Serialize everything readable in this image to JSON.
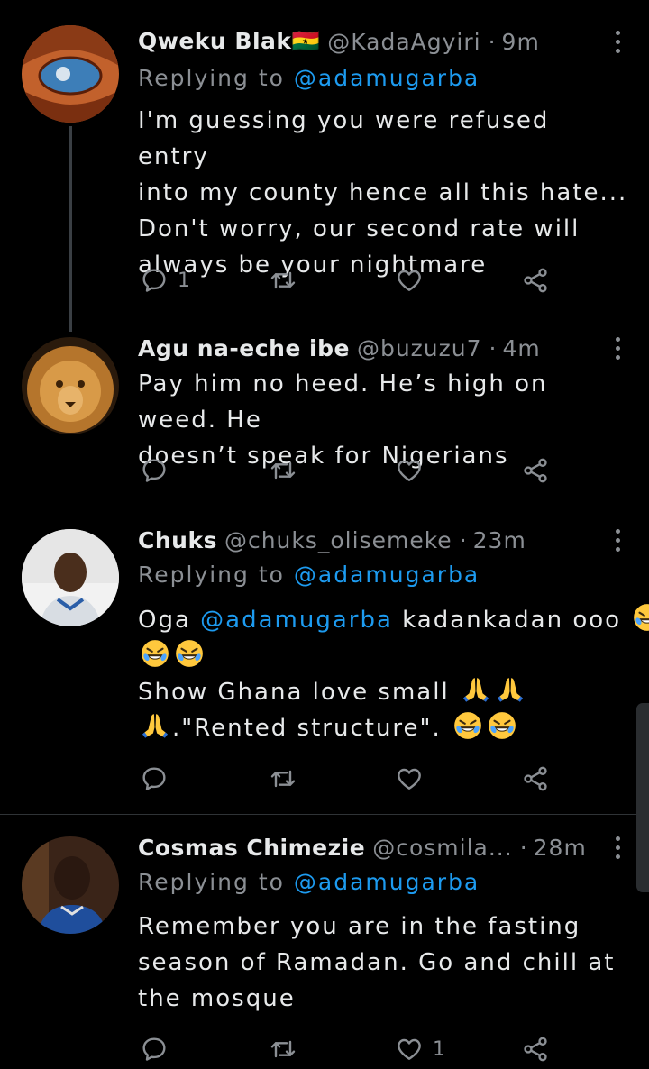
{
  "tweets": [
    {
      "name": "Qweku Blak🇬🇭",
      "handle": "@KadaAgyiri",
      "dot": "·",
      "time": "9m",
      "replying_label": "Replying to ",
      "replying_to": "@adamugarba",
      "body": "I'm guessing you were refused entry\ninto my county hence all this hate...\nDon't worry, our second rate will\nalways be your nightmare",
      "reply_count": "1",
      "retweet_count": "",
      "like_count": ""
    },
    {
      "name": "Agu na-eche ibe",
      "handle": "@buzuzu7",
      "dot": "·",
      "time": "4m",
      "body": "Pay him no heed. He’s high on weed. He\ndoesn’t speak for Nigerians",
      "reply_count": "",
      "retweet_count": "",
      "like_count": ""
    },
    {
      "name": "Chuks",
      "handle": "@chuks_olisemeke",
      "dot": "·",
      "time": "23m",
      "replying_label": "Replying to ",
      "replying_to": "@adamugarba",
      "body_prefix": "Oga ",
      "body_mention": "@adamugarba",
      "body_suffix": " kadankadan ooo",
      "body_line3": "Show Ghana love small",
      "body_line4": ".\"Rented structure\".",
      "reply_count": "",
      "retweet_count": "",
      "like_count": ""
    },
    {
      "name": "Cosmas Chimezie",
      "handle": "@cosmila...",
      "dot": "·",
      "time": "28m",
      "replying_label": "Replying to ",
      "replying_to": "@adamugarba",
      "body": "Remember you are in the fasting\nseason of Ramadan. Go and chill at\nthe mosque",
      "reply_count": "",
      "retweet_count": "",
      "like_count": "1"
    }
  ],
  "icons": {
    "reply": "reply-icon",
    "retweet": "retweet-icon",
    "like": "heart-icon",
    "share": "share-icon",
    "more": "more-icon",
    "laugh": "rofl-emoji",
    "pray": "pray-emoji"
  },
  "colors": {
    "background": "#000000",
    "text": "#e7e9ea",
    "secondary": "#8b8f94",
    "accent": "#1d9bf0"
  }
}
